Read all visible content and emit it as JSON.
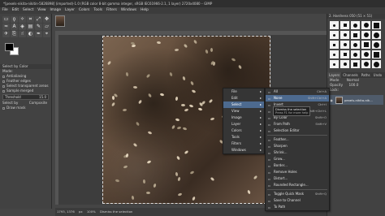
{
  "window": {
    "title": "*[pexels-nikita-nikitin-5826898] (imported)-1.0 (RGB color 8-bit gamma integer, sRGB IEC61966-2.1, 1 layer) 2720x4080 – GIMP"
  },
  "menubar": [
    "File",
    "Edit",
    "Select",
    "View",
    "Image",
    "Layer",
    "Colors",
    "Tools",
    "Filters",
    "Windows",
    "Help"
  ],
  "left_panel": {
    "tool_options_title": "Select by Color",
    "options": [
      "Mode:",
      "Antialiasing",
      "Feather edges",
      "Select transparent areas",
      "Sample merged"
    ],
    "threshold_label": "Threshold",
    "threshold_value": "15.0",
    "select_by_label": "Select by",
    "select_by_value": "Composite",
    "draw_mask_label": "Draw mask"
  },
  "right_panel": {
    "brush_header": "2. Hardness 050 (51 × 51)",
    "tabs": [
      "Layers",
      "Channels",
      "Paths",
      "Undo"
    ],
    "mode_label": "Mode",
    "mode_value": "Normal",
    "opacity_label": "Opacity",
    "opacity_value": "100.0",
    "lock_label": "Lock:",
    "layer_name": "pexels-nikita-nik..."
  },
  "statusbar": {
    "coords": "1793, 1376",
    "unit": "px",
    "zoom": "100%",
    "message": "Dismiss the selection"
  },
  "context_menu": {
    "items": [
      {
        "label": "File",
        "submenu": true
      },
      {
        "label": "Edit",
        "submenu": true
      },
      {
        "label": "Select",
        "submenu": true,
        "selected": true
      },
      {
        "label": "View",
        "submenu": true
      },
      {
        "label": "Image",
        "submenu": true
      },
      {
        "label": "Layer",
        "submenu": true
      },
      {
        "label": "Colors",
        "submenu": true
      },
      {
        "label": "Tools",
        "submenu": true
      },
      {
        "label": "Filters",
        "submenu": true
      },
      {
        "label": "Windows",
        "submenu": true
      }
    ]
  },
  "select_menu": {
    "items": [
      {
        "label": "All",
        "shortcut": "Ctrl+A"
      },
      {
        "label": "None",
        "shortcut": "Shift+Ctrl+A",
        "selected": true
      },
      {
        "label": "Invert",
        "shortcut": "Ctrl+I"
      },
      {
        "label": "Float",
        "shortcut": "Shift+Ctrl+L"
      },
      {
        "label": "By Color",
        "shortcut": "Shift+O"
      },
      {
        "label": "From Path",
        "shortcut": "Shift+V"
      },
      {
        "label": "Selection Editor",
        "shortcut": ""
      },
      {
        "sep": true
      },
      {
        "label": "Feather...",
        "shortcut": ""
      },
      {
        "label": "Sharpen",
        "shortcut": ""
      },
      {
        "label": "Shrink...",
        "shortcut": ""
      },
      {
        "label": "Grow...",
        "shortcut": ""
      },
      {
        "label": "Border...",
        "shortcut": ""
      },
      {
        "label": "Remove Holes",
        "shortcut": ""
      },
      {
        "label": "Distort...",
        "shortcut": ""
      },
      {
        "label": "Rounded Rectangle...",
        "shortcut": ""
      },
      {
        "sep": true
      },
      {
        "label": "Toggle Quick Mask",
        "shortcut": "Shift+Q"
      },
      {
        "label": "Save to Channel",
        "shortcut": ""
      },
      {
        "label": "To Path",
        "shortcut": ""
      }
    ]
  },
  "tooltip": {
    "text": "Dismiss the selection",
    "hint": "Press F1 for more help"
  }
}
